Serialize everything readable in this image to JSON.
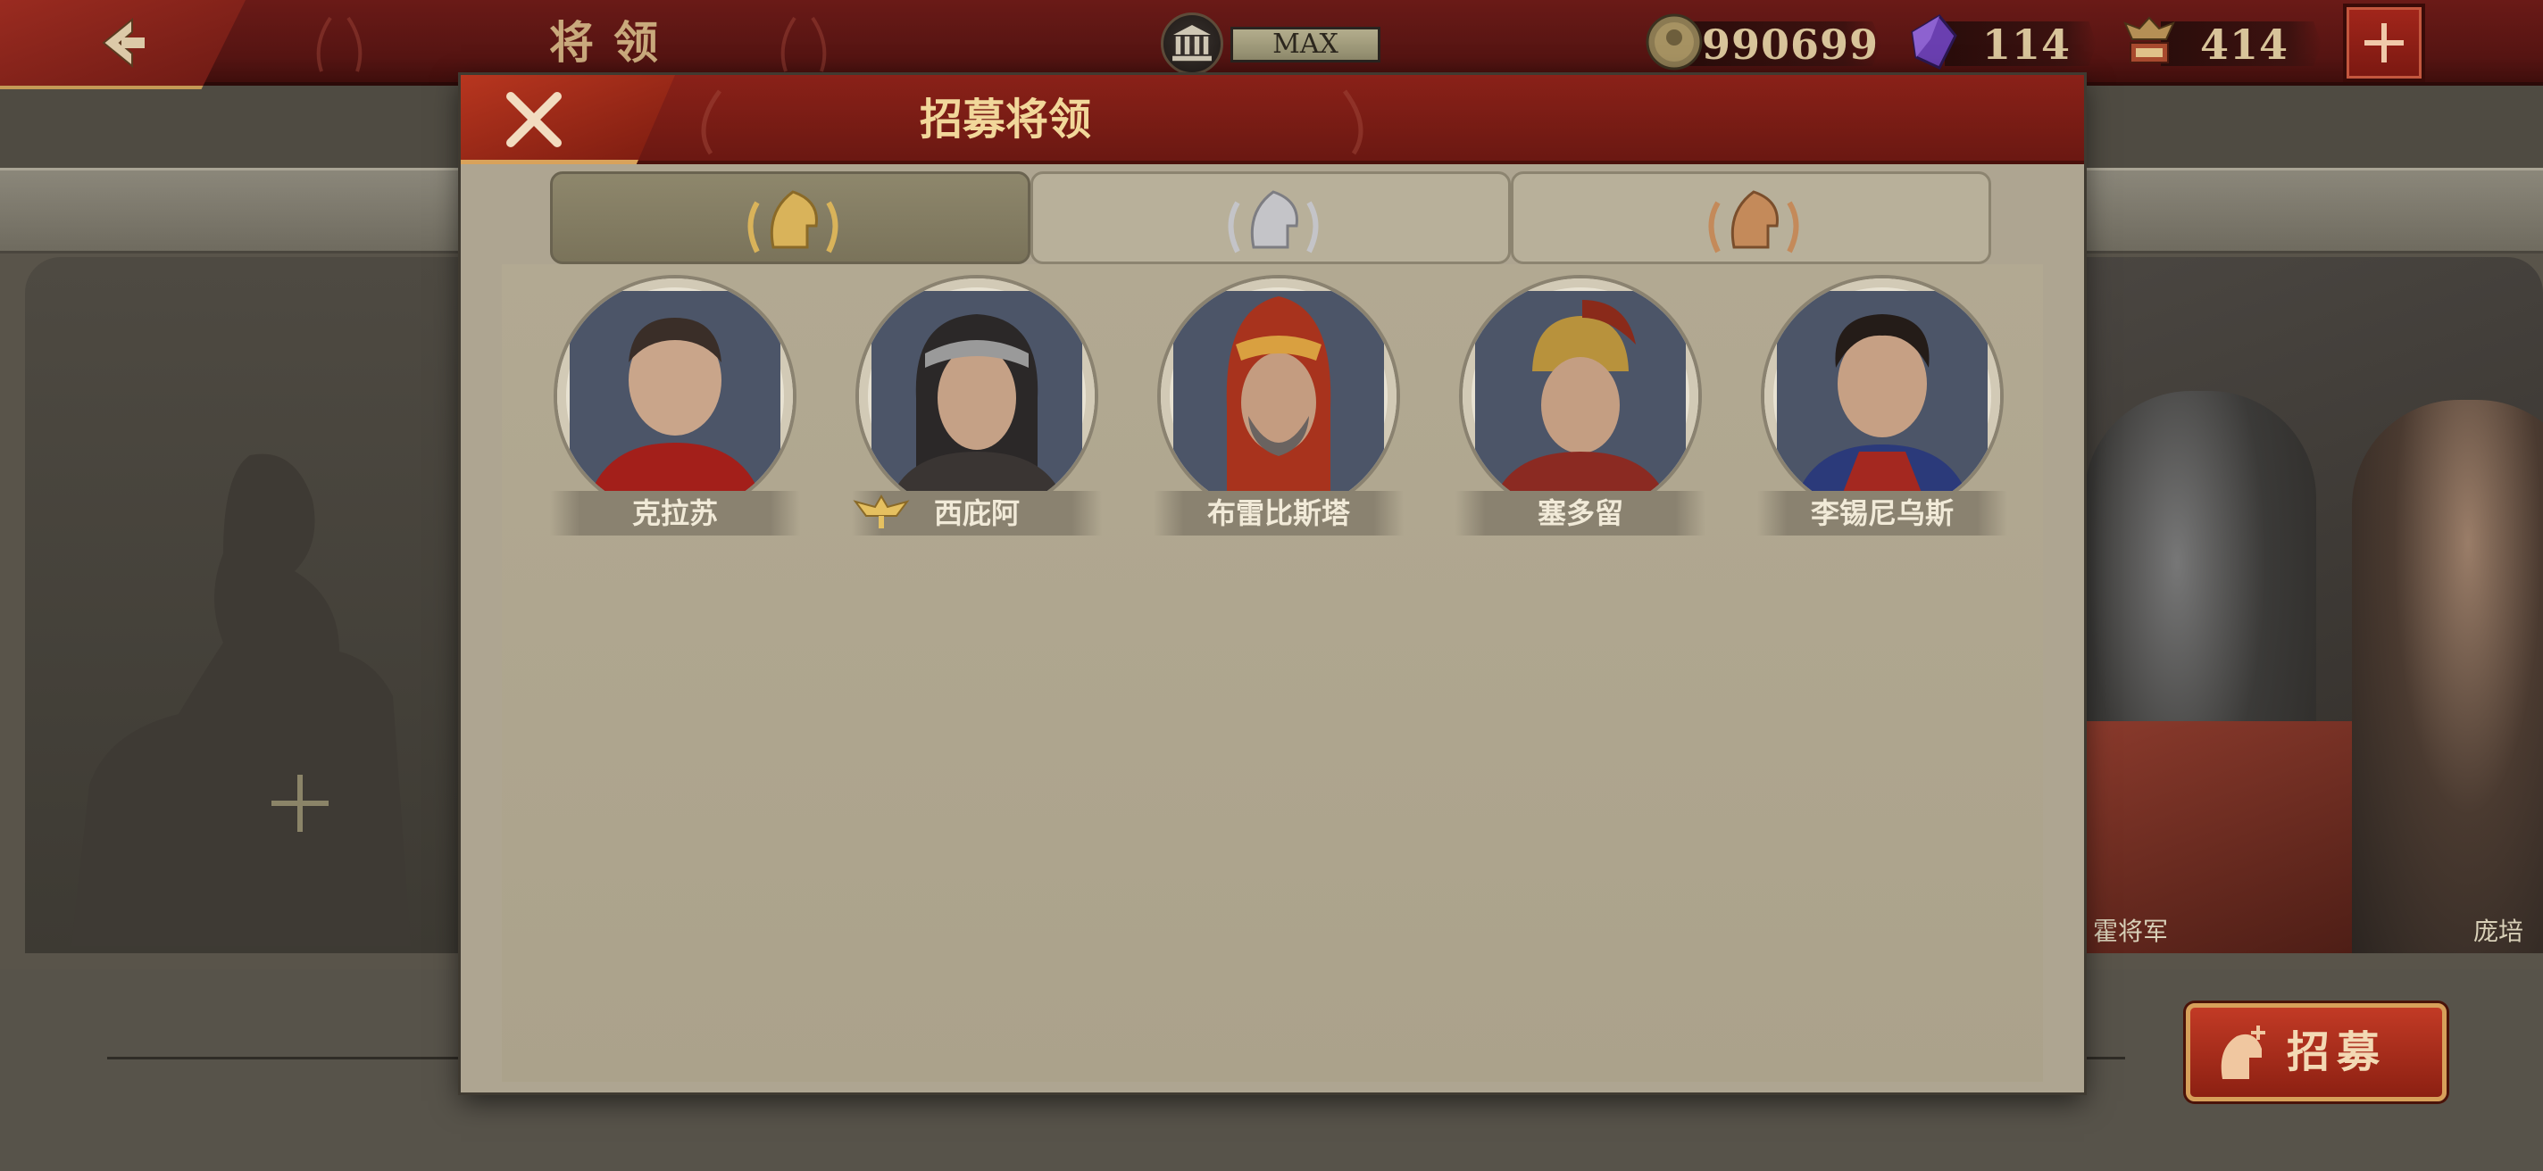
{
  "topbar": {
    "title": "将领",
    "max_label": "MAX",
    "resources": [
      {
        "name": "coin",
        "value": "990699",
        "icon": "coin-icon"
      },
      {
        "name": "gem",
        "value": "114",
        "icon": "purple-gem-icon"
      },
      {
        "name": "spqr",
        "value": "414",
        "icon": "spqr-eagle-icon"
      }
    ]
  },
  "background": {
    "general_names": [
      "霍将军",
      "庞培"
    ],
    "recruit_button_label": "招募"
  },
  "modal": {
    "title": "招募将领",
    "tabs": [
      {
        "tier": "gold",
        "active": true
      },
      {
        "tier": "silver",
        "active": false
      },
      {
        "tier": "bronze",
        "active": false
      }
    ],
    "generals": [
      {
        "name": "克拉苏",
        "has_eagle": false
      },
      {
        "name": "西庇阿",
        "has_eagle": true
      },
      {
        "name": "布雷比斯塔",
        "has_eagle": false
      },
      {
        "name": "塞多留",
        "has_eagle": false
      },
      {
        "name": "李锡尼乌斯",
        "has_eagle": false
      }
    ]
  },
  "colors": {
    "header_red": "#6b1812",
    "gold": "#d9b35a",
    "silver": "#c4c4c8",
    "bronze": "#c48a5a",
    "parchment": "#aea591"
  }
}
